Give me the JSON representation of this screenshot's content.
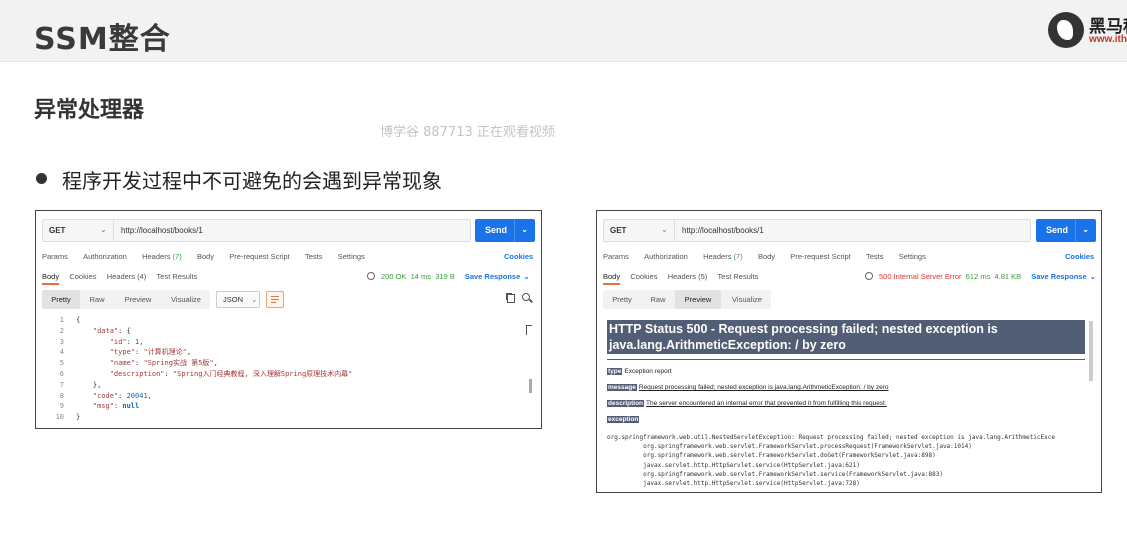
{
  "slide": {
    "title": "SSM整合",
    "subtitle": "异常处理器",
    "watermark": "博学谷 887713 正在观看视频",
    "bullet": "程序开发过程中不可避免的会遇到异常现象",
    "logo": {
      "name": "黑马程",
      "url": "www.ith"
    }
  },
  "left": {
    "method": "GET",
    "url": "http://localhost/books/1",
    "send": "Send",
    "tabs": {
      "params": "Params",
      "authorization": "Authorization",
      "headers": "Headers",
      "headers_count": "(7)",
      "body": "Body",
      "prerequest": "Pre-request Script",
      "tests": "Tests",
      "settings": "Settings"
    },
    "cookies": "Cookies",
    "resp_tabs": {
      "body": "Body",
      "cookies": "Cookies",
      "headers": "Headers",
      "headers_count": "(4)",
      "tests": "Test Results"
    },
    "status": "200 OK",
    "time": "14 ms",
    "size": "319 B",
    "save": "Save Response",
    "views": {
      "pretty": "Pretty",
      "raw": "Raw",
      "preview": "Preview",
      "visualize": "Visualize"
    },
    "format": "JSON",
    "code_lines": [
      {
        "n": "1",
        "text": "{"
      },
      {
        "n": "2",
        "text": "    \"data\": {"
      },
      {
        "n": "3",
        "text": "        \"id\": 1,"
      },
      {
        "n": "4",
        "text": "        \"type\": \"计算机理论\","
      },
      {
        "n": "5",
        "text": "        \"name\": \"Spring实战 第5版\","
      },
      {
        "n": "6",
        "text": "        \"description\": \"Spring入门经典教程, 深入理解Spring原理技术内幕\""
      },
      {
        "n": "7",
        "text": "    },"
      },
      {
        "n": "8",
        "text": "    \"code\": 20041,"
      },
      {
        "n": "9",
        "text": "    \"msg\": null"
      },
      {
        "n": "10",
        "text": "}"
      }
    ]
  },
  "right": {
    "method": "GET",
    "url": "http://localhost/books/1",
    "send": "Send",
    "tabs": {
      "params": "Params",
      "authorization": "Authorization",
      "headers": "Headers",
      "headers_count": "(7)",
      "body": "Body",
      "prerequest": "Pre-request Script",
      "tests": "Tests",
      "settings": "Settings"
    },
    "cookies": "Cookies",
    "resp_tabs": {
      "body": "Body",
      "cookies": "Cookies",
      "headers": "Headers",
      "headers_count": "(5)",
      "tests": "Test Results"
    },
    "status": "500 Internal Server Error",
    "time": "612 ms",
    "size": "4.81 KB",
    "save": "Save Response",
    "views": {
      "pretty": "Pretty",
      "raw": "Raw",
      "preview": "Preview",
      "visualize": "Visualize"
    },
    "error": {
      "banner": "HTTP Status 500 - Request processing failed; nested exception is java.lang.ArithmeticException: / by zero",
      "type_label": "type",
      "type_text": "Exception report",
      "message_label": "message",
      "message_text": "Request processing failed; nested exception is java.lang.ArithmeticException: / by zero",
      "description_label": "description",
      "description_text": "The server encountered an internal error that prevented it from fulfilling this request.",
      "exception_label": "exception",
      "stack": [
        "org.springframework.web.util.NestedServletException: Request processing failed; nested exception is java.lang.ArithmeticExce",
        "\torg.springframework.web.servlet.FrameworkServlet.processRequest(FrameworkServlet.java:1014)",
        "\torg.springframework.web.servlet.FrameworkServlet.doGet(FrameworkServlet.java:898)",
        "\tjavax.servlet.http.HttpServlet.service(HttpServlet.java:621)",
        "\torg.springframework.web.servlet.FrameworkServlet.service(FrameworkServlet.java:883)",
        "\tjavax.servlet.http.HttpServlet.service(HttpServlet.java:728)"
      ]
    }
  }
}
